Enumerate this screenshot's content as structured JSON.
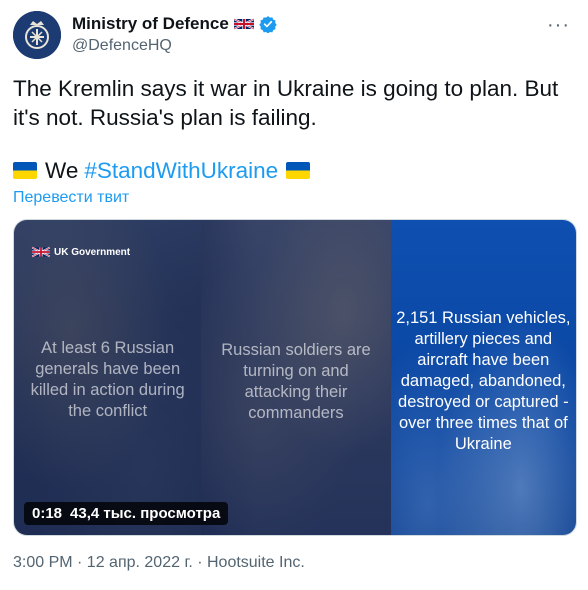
{
  "header": {
    "name": "Ministry of Defence",
    "handle": "@DefenceHQ",
    "more_label": "···"
  },
  "tweet": {
    "text": "The Kremlin says it war in Ukraine is going to plan. But it's not. Russia's plan is failing.",
    "we_word": "We",
    "hashtag": "#StandWithUkraine",
    "translate": "Перевести твит"
  },
  "media": {
    "logo_text": "UK Government",
    "captions": [
      "At least 6 Russian generals have been killed in action during the conflict",
      "Russian soldiers are turning on and attacking their commanders",
      "2,151 Russian vehicles, artillery pieces and aircraft have been damaged, abandoned, destroyed or captured - over three times that of Ukraine"
    ],
    "video_time": "0:18",
    "views": "43,4 тыс. просмотра"
  },
  "footer": {
    "meta": "3:00 PM · 12 апр. 2022 г. · Hootsuite Inc."
  },
  "colors": {
    "link": "#1d9bf0",
    "verified": "#1d9bf0",
    "avatar_bg": "#1d3b73",
    "panel_blue": "#0b47a3",
    "ua_blue": "#0057b7",
    "ua_yellow": "#ffd700"
  },
  "icons": [
    "avatar-crest",
    "uk-flag-icon",
    "verified-icon",
    "more-icon",
    "ukraine-flag-icon",
    "ukgov-flag-icon"
  ]
}
